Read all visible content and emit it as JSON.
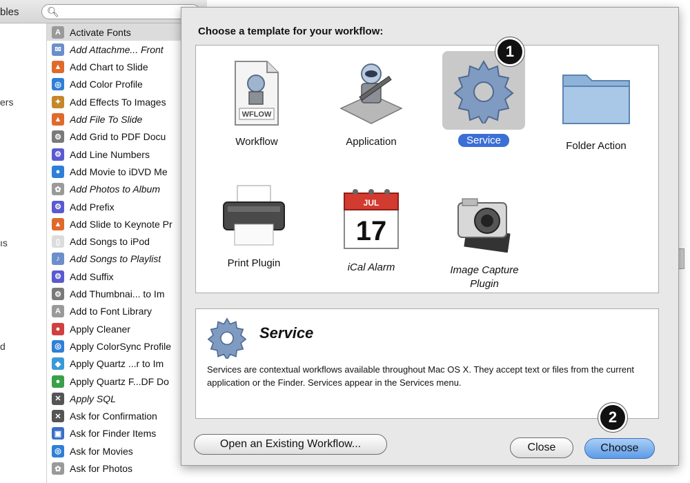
{
  "window": {
    "toolbar_label": "bles",
    "search_icon": "magnifier-icon"
  },
  "left_col": {
    "items": [
      "ers",
      "ıs",
      "d"
    ]
  },
  "actions": [
    {
      "label": "Activate Fonts",
      "color": "#9a9a9a",
      "glyph": "A"
    },
    {
      "label": "Add Attachme... Front",
      "color": "#6b8fc9",
      "glyph": "✉",
      "italic": true
    },
    {
      "label": "Add Chart to Slide",
      "color": "#e06a2c",
      "glyph": "▲"
    },
    {
      "label": "Add Color Profile",
      "color": "#2f7fd8",
      "glyph": "◎"
    },
    {
      "label": "Add Effects To Images",
      "color": "#c6862a",
      "glyph": "✦"
    },
    {
      "label": "Add File To Slide",
      "color": "#e06a2c",
      "glyph": "▲",
      "italic": true
    },
    {
      "label": "Add Grid to PDF Docu",
      "color": "#7a7a7a",
      "glyph": "⚙"
    },
    {
      "label": "Add Line Numbers",
      "color": "#5a5ad0",
      "glyph": "⚙"
    },
    {
      "label": "Add Movie to iDVD Me",
      "color": "#2f7fd8",
      "glyph": "●"
    },
    {
      "label": "Add Photos to Album",
      "color": "#9a9a9a",
      "glyph": "✿",
      "italic": true
    },
    {
      "label": "Add Prefix",
      "color": "#5a5ad0",
      "glyph": "⚙"
    },
    {
      "label": "Add Slide to Keynote Pr",
      "color": "#e06a2c",
      "glyph": "▲"
    },
    {
      "label": "Add Songs to iPod",
      "color": "#dcdcdc",
      "glyph": "▯"
    },
    {
      "label": "Add Songs to Playlist",
      "color": "#6b8fc9",
      "glyph": "♪",
      "italic": true
    },
    {
      "label": "Add Suffix",
      "color": "#5a5ad0",
      "glyph": "⚙"
    },
    {
      "label": "Add Thumbnai... to Im",
      "color": "#7a7a7a",
      "glyph": "⚙"
    },
    {
      "label": "Add to Font Library",
      "color": "#9a9a9a",
      "glyph": "A"
    },
    {
      "label": "Apply Cleaner",
      "color": "#d04040",
      "glyph": "●"
    },
    {
      "label": "Apply ColorSync Profile",
      "color": "#2f7fd8",
      "glyph": "◎"
    },
    {
      "label": "Apply Quartz ...r to Im",
      "color": "#3a9ad8",
      "glyph": "◆"
    },
    {
      "label": "Apply Quartz F...DF Do",
      "color": "#3aa04a",
      "glyph": "●"
    },
    {
      "label": "Apply SQL",
      "color": "#555555",
      "glyph": "✕",
      "italic": true
    },
    {
      "label": "Ask for Confirmation",
      "color": "#555555",
      "glyph": "✕"
    },
    {
      "label": "Ask for Finder Items",
      "color": "#3a6fc8",
      "glyph": "▣"
    },
    {
      "label": "Ask for Movies",
      "color": "#2f7fd8",
      "glyph": "◎"
    },
    {
      "label": "Ask for Photos",
      "color": "#9a9a9a",
      "glyph": "✿"
    }
  ],
  "sheet": {
    "title": "Choose a template for your workflow:",
    "templates": [
      {
        "id": "workflow",
        "label": "Workflow",
        "icon": "wflow-document-icon",
        "badge": "WFLOW"
      },
      {
        "id": "application",
        "label": "Application",
        "icon": "automator-robot-icon"
      },
      {
        "id": "service",
        "label": "Service",
        "icon": "gear-icon",
        "selected": true
      },
      {
        "id": "folder-action",
        "label": "Folder Action",
        "icon": "folder-icon"
      },
      {
        "id": "print-plugin",
        "label": "Print Plugin",
        "icon": "printer-icon"
      },
      {
        "id": "ical-alarm",
        "label": "iCal Alarm",
        "icon": "calendar-icon",
        "cal_month": "JUL",
        "cal_day": "17",
        "italic": true
      },
      {
        "id": "image-capture",
        "label": "Image Capture Plugin",
        "icon": "camera-icon",
        "italic": true
      }
    ],
    "description": {
      "title": "Service",
      "icon": "gear-icon",
      "text": "Services are contextual workflows available throughout Mac OS X. They accept text or files from the current application or the Finder. Services appear in the Services menu."
    },
    "buttons": {
      "open_existing": "Open an Existing Workflow...",
      "close": "Close",
      "choose": "Choose"
    },
    "callouts": [
      "1",
      "2"
    ]
  }
}
